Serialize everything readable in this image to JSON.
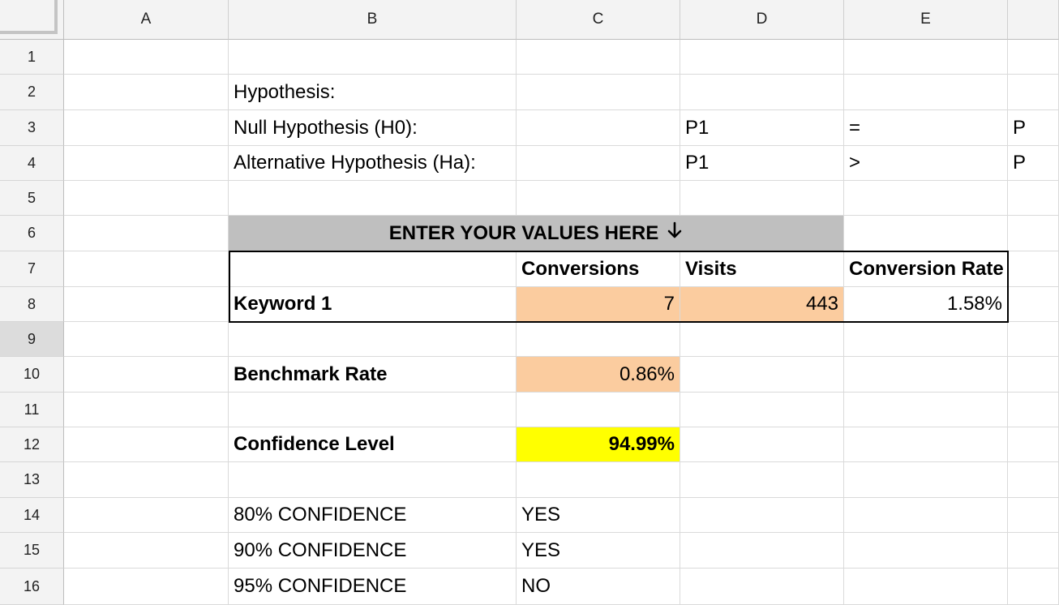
{
  "columns": [
    "A",
    "B",
    "C",
    "D",
    "E"
  ],
  "rows": [
    "1",
    "2",
    "3",
    "4",
    "5",
    "6",
    "7",
    "8",
    "9",
    "10",
    "11",
    "12",
    "13",
    "14",
    "15",
    "16"
  ],
  "cells": {
    "B2": "Hypothesis:",
    "B3": "Null Hypothesis (H0):",
    "D3": "P1",
    "E3": "=",
    "F3": "P",
    "B4": "Alternative Hypothesis (Ha):",
    "D4": "P1",
    "E4": ">",
    "F4": "P",
    "B6": "ENTER YOUR VALUES HERE",
    "C7": "Conversions",
    "D7": "Visits",
    "E7": "Conversion Rate",
    "B8": "Keyword 1",
    "C8": "7",
    "D8": "443",
    "E8": "1.58%",
    "B10": "Benchmark Rate",
    "C10": "0.86%",
    "B12": "Confidence Level",
    "C12": "94.99%",
    "B14": "80% CONFIDENCE",
    "C14": "YES",
    "B15": "90% CONFIDENCE",
    "C15": "YES",
    "B16": "95% CONFIDENCE",
    "C16": "NO"
  },
  "icons": {
    "header_arrow": "arrow-down-icon"
  },
  "colors": {
    "input_fill": "#fbcc9f",
    "result_fill": "#ffff00",
    "header_fill": "#bfbfbf"
  }
}
